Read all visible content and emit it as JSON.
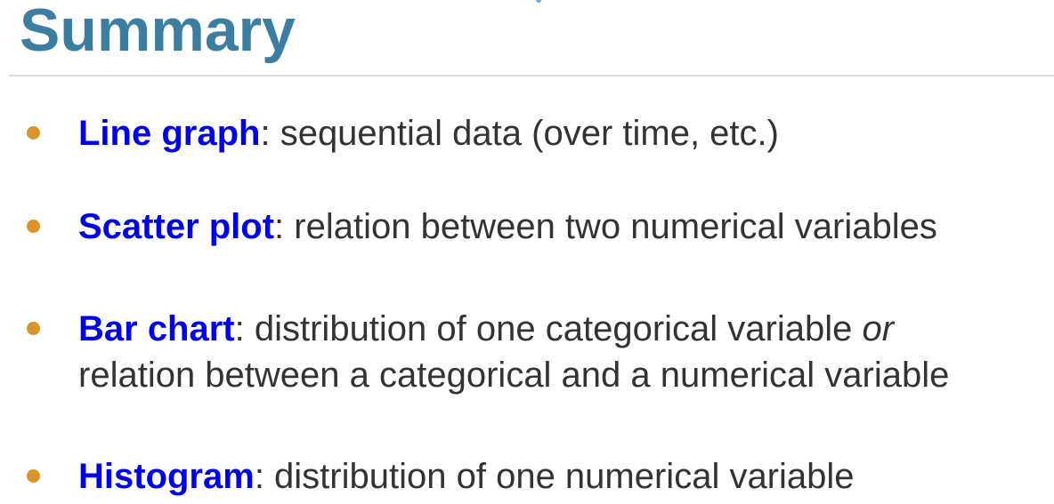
{
  "title": "Summary",
  "accent_colors": {
    "title": "#3b7ea1",
    "term": "#0000ee",
    "bullet": "#d9952a",
    "body_text": "#333333"
  },
  "bullets": [
    {
      "term": "Line graph",
      "separator": ":",
      "text": " sequential data (over time, etc.)"
    },
    {
      "term": "Scatter plot",
      "separator": ":",
      "text": " relation between two numerical variables"
    },
    {
      "term": "Bar chart",
      "separator": ":",
      "text": " distribution of one categorical variable ",
      "emphasis": "or",
      "line2": "relation between a categorical and a numerical variable"
    },
    {
      "term": "Histogram",
      "separator": ":",
      "text": " distribution of one numerical variable"
    }
  ]
}
